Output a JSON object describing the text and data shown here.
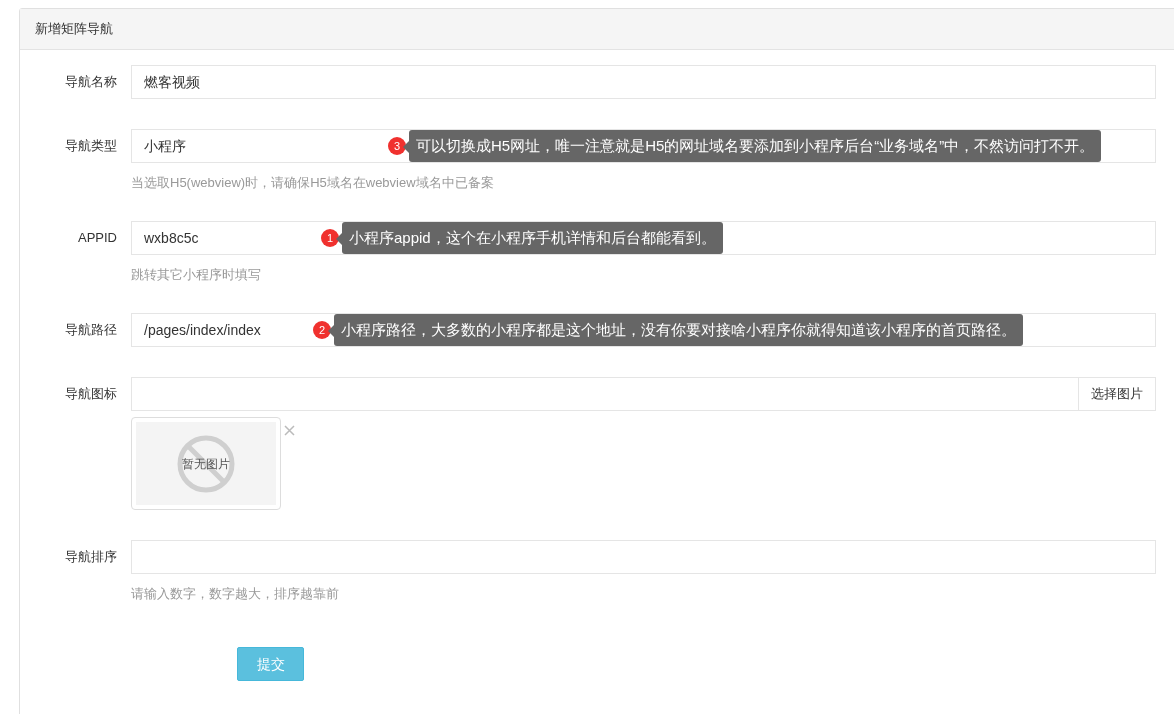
{
  "panel": {
    "title": "新增矩阵导航"
  },
  "fields": [
    {
      "kind": "text",
      "label": "导航名称",
      "value": "燃客视频"
    },
    {
      "kind": "text",
      "label": "导航类型",
      "value": "小程序",
      "help": "当选取H5(webview)时，请确保H5域名在webview域名中已备案",
      "annotation": {
        "number": "3",
        "text": "可以切换成H5网址，唯一注意就是H5的网址域名要添加到小程序后台“业务域名”中，不然访问打不开。"
      }
    },
    {
      "kind": "text",
      "label": "APPID",
      "value": "wxb8c5c",
      "help": "跳转其它小程序时填写",
      "annotation": {
        "number": "1",
        "text": "小程序appid，这个在小程序手机详情和后台都能看到。"
      }
    },
    {
      "kind": "text",
      "label": "导航路径",
      "value": "/pages/index/index",
      "annotation": {
        "number": "2",
        "text": "小程序路径，大多数的小程序都是这个地址，没有你要对接啥小程序你就得知道该小程序的首页路径。"
      }
    },
    {
      "kind": "image",
      "label": "导航图标",
      "button": "选择图片",
      "empty_image": "暂无图片"
    },
    {
      "kind": "text",
      "label": "导航排序",
      "help": "请输入数字，数字越大，排序越靠前"
    }
  ],
  "submit": "提交"
}
